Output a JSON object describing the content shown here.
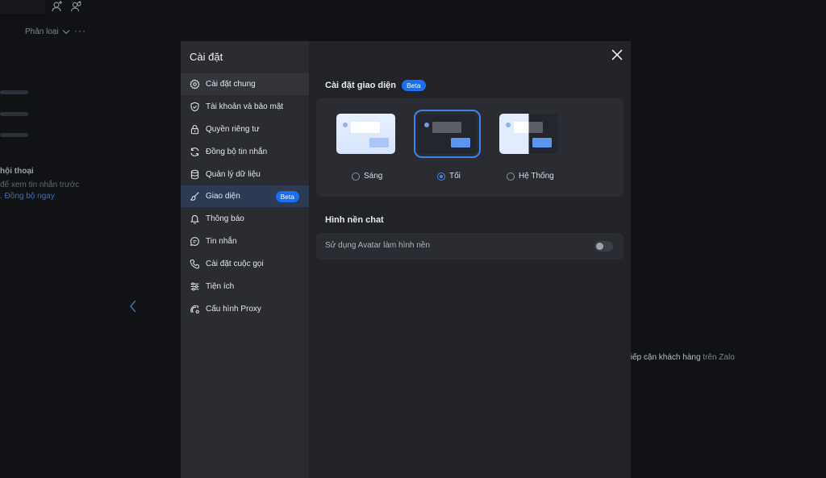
{
  "background": {
    "filter_label": "Phân loại",
    "more_label": "···",
    "conversation_heading": "hội thoại",
    "sync_message": "để xem tin nhắn trước",
    "sync_link": ". Đồng bộ ngay",
    "promo_highlight": "tiếp cận khách hàng",
    "promo_suffix": " trên Zalo"
  },
  "modal": {
    "title": "Cài đặt",
    "close_icon": "close-icon",
    "sidebar": {
      "items": [
        {
          "label": "Cài đặt chung",
          "icon": "gear-icon"
        },
        {
          "label": "Tài khoản và bảo mật",
          "icon": "shield-icon"
        },
        {
          "label": "Quyền riêng tư",
          "icon": "lock-icon"
        },
        {
          "label": "Đồng bộ tin nhắn",
          "icon": "sync-icon"
        },
        {
          "label": "Quản lý dữ liệu",
          "icon": "database-icon"
        },
        {
          "label": "Giao diện",
          "icon": "brush-icon",
          "badge": "Beta"
        },
        {
          "label": "Thông báo",
          "icon": "bell-icon"
        },
        {
          "label": "Tin nhắn",
          "icon": "chat-icon"
        },
        {
          "label": "Cài đặt cuộc gọi",
          "icon": "phone-icon"
        },
        {
          "label": "Tiện ích",
          "icon": "sliders-icon"
        },
        {
          "label": "Cấu hình Proxy",
          "icon": "proxy-icon"
        }
      ]
    },
    "appearance": {
      "title": "Cài đặt giao diện",
      "badge": "Beta",
      "options": [
        {
          "label": "Sáng",
          "selected": false
        },
        {
          "label": "Tối",
          "selected": true
        },
        {
          "label": "Hệ Thống",
          "selected": false
        }
      ]
    },
    "wallpaper": {
      "title": "Hình nền chat",
      "option_label": "Sử dụng Avatar làm hình nền",
      "enabled": false
    }
  },
  "colors": {
    "accent": "#1a6ef5",
    "selection": "#3f82e8",
    "modal_bg": "#222327",
    "sidebar_bg": "#2a2c31"
  }
}
